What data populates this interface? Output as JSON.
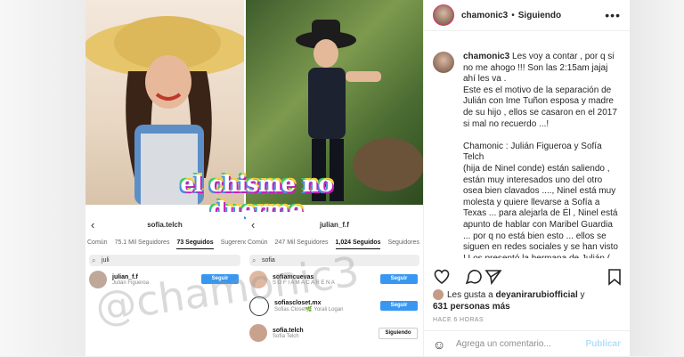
{
  "post": {
    "username": "chamonic3",
    "follow_status": "Siguiendo",
    "caption_lines": [
      "Les voy a contar , por q si",
      "no me ahogo !!! Son las 2:15am jajaj",
      "ahí les va .",
      "Este es el motivo de la separación de",
      "Julián con Ime Tuñon esposa y madre",
      "de su hijo , ellos se casaron en el 2017",
      "si mal no recuerdo ...!",
      "",
      "Chamonic : Julián Figueroa y Sofía",
      "Telch",
      "(hija de Ninel conde) están saliendo ,",
      "están muy interesados uno del otro",
      "osea bien clavados ...., Ninel está muy",
      "molesta y quiere llevarse a Sofía a",
      "Texas ... para alejarla de Él , Ninel está",
      "apunto de hablar con Maribel Guardia",
      "... por q no está bien esto ... ellos se",
      "siguen en redes sociales y se han visto",
      "! Los presentó la hermana de Julián ("
    ],
    "likes_prefix": "Les gusta a",
    "liked_by": "deyanirarubiofficial",
    "likes_and": "y",
    "likes_count": "631 personas más",
    "time_ago": "HACE 6 HORAS",
    "comment_placeholder": "Agrega un comentario...",
    "publish_label": "Publicar"
  },
  "image": {
    "banner": "el chisme no duerme",
    "watermark": "@chamonic3",
    "left_profile": {
      "username": "sofia.telch",
      "tabs": [
        "Común",
        "75.1 Mil Seguidores",
        "73 Seguidos",
        "Sugerencias"
      ],
      "search": "juli",
      "rows": [
        {
          "name": "julian_f.f",
          "sub": "Julián Figueroa",
          "button": "Seguir"
        }
      ]
    },
    "right_profile": {
      "username": "julian_f.f",
      "tabs": [
        "Común",
        "247 Mil Seguidores",
        "1,024 Seguidos",
        "Seguidores"
      ],
      "search": "sofia",
      "rows": [
        {
          "name": "sofiamcuevas",
          "sub": "S O F I A  M A C A R E N A",
          "button": "Seguir"
        },
        {
          "name": "sofiascloset.mx",
          "sub": "Sofias Closet🌿 Yorali Logan",
          "button": "Seguir"
        },
        {
          "name": "sofia.telch",
          "sub": "Sofía Telch",
          "button": "Siguiendo"
        }
      ]
    }
  },
  "icons": [
    "heart-icon",
    "comment-icon",
    "share-icon",
    "bookmark-icon",
    "more-icon",
    "emoji-icon",
    "back-arrow-icon",
    "search-icon"
  ],
  "colors": {
    "accent_blue": "#3897f0",
    "publish_disabled": "#b2dffc",
    "ring": "#e1306c"
  }
}
